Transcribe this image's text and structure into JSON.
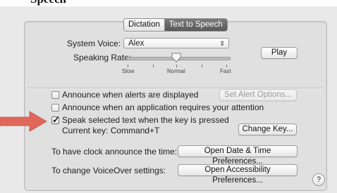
{
  "page_title_partial": "Speech",
  "tabs": [
    {
      "label": "Dictation",
      "selected": false
    },
    {
      "label": "Text to Speech",
      "selected": true
    }
  ],
  "system_voice": {
    "label": "System Voice:",
    "value": "Alex"
  },
  "speaking_rate": {
    "label": "Speaking Rate:",
    "slow": "Slow",
    "normal": "Normal",
    "fast": "Fast",
    "level": 0.5
  },
  "play_button": "Play",
  "options": {
    "announce_alerts": {
      "label": "Announce when alerts are displayed",
      "checked": false
    },
    "set_alert_options": "Set Alert Options...",
    "announce_attention": {
      "label": "Announce when an application requires your attention",
      "checked": false
    },
    "speak_selected": {
      "label": "Speak selected text when the key is pressed",
      "checked": true
    },
    "current_key": "Current key: Command+T",
    "change_key": "Change Key..."
  },
  "clock": {
    "label": "To have clock announce the time:",
    "button": "Open Date & Time Preferences..."
  },
  "voiceover": {
    "label": "To change VoiceOver settings:",
    "button": "Open Accessibility Preferences..."
  },
  "help_button": "?",
  "colors": {
    "annotation_arrow": "#e0685a",
    "selected_tab": "#5f5f5f"
  }
}
